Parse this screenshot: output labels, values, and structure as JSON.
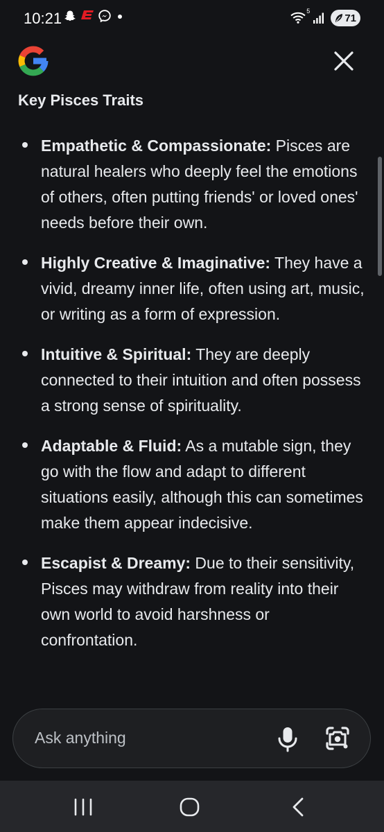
{
  "status_bar": {
    "time": "10:21",
    "notification_icons": [
      "snapchat-icon",
      "espn-icon",
      "messenger-icon",
      "dot-icon"
    ],
    "system_icons": [
      "wifi-icon",
      "signal-icon"
    ],
    "wifi_badge": "5",
    "battery": "71"
  },
  "header": {
    "logo": "google-g-logo",
    "close_icon": "close-icon"
  },
  "section_title": "Key Pisces Traits",
  "traits": [
    {
      "heading": "Empathetic & Compassionate:",
      "text": " Pisces are natural healers who deeply feel the emotions of others, often putting friends' or loved ones' needs before their own."
    },
    {
      "heading": "Highly Creative & Imaginative:",
      "text": " They have a vivid, dreamy inner life, often using art, music, or writing as a form of expression."
    },
    {
      "heading": "Intuitive & Spiritual:",
      "text": " They are deeply connected to their intuition and often possess a strong sense of spirituality."
    },
    {
      "heading": "Adaptable & Fluid:",
      "text": " As a mutable sign, they go with the flow and adapt to different situations easily, although this can sometimes make them appear indecisive."
    },
    {
      "heading": "Escapist & Dreamy:",
      "text": " Due to their sensitivity, Pisces may withdraw from reality into their own world to avoid harshness or confrontation."
    }
  ],
  "ask_bar": {
    "placeholder": "Ask anything",
    "mic_icon": "mic-icon",
    "lens_icon": "google-lens-icon"
  },
  "nav_bar": {
    "icons": [
      "recents-icon",
      "home-icon",
      "back-icon"
    ]
  },
  "colors": {
    "background": "#131417",
    "text": "#e8eaed",
    "ask_bar_bg": "#1e1f22",
    "nav_bar_bg": "#26272b"
  }
}
